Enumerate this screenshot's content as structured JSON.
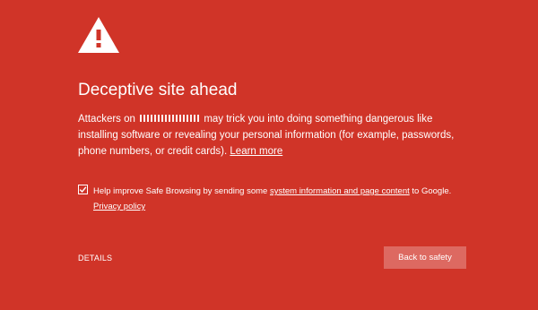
{
  "page": {
    "background_color": "#d03428",
    "icon": "warning-triangle-icon"
  },
  "heading": {
    "title": "Deceptive site ahead"
  },
  "message": {
    "prefix": "Attackers on",
    "site": "[redacted]",
    "suffix": " may trick you into doing something dangerous like installing software or revealing your personal information (for example, passwords, phone numbers, or credit cards).",
    "learn_more": "Learn more"
  },
  "safe_browsing": {
    "checked": true,
    "text_before": "Help improve Safe Browsing by sending some ",
    "link_text": "system information and page content",
    "text_after": " to Google.",
    "privacy_link": "Privacy policy"
  },
  "actions": {
    "details_label": "DETAILS",
    "back_label": "Back to safety",
    "back_button_color": "#dd6961"
  }
}
